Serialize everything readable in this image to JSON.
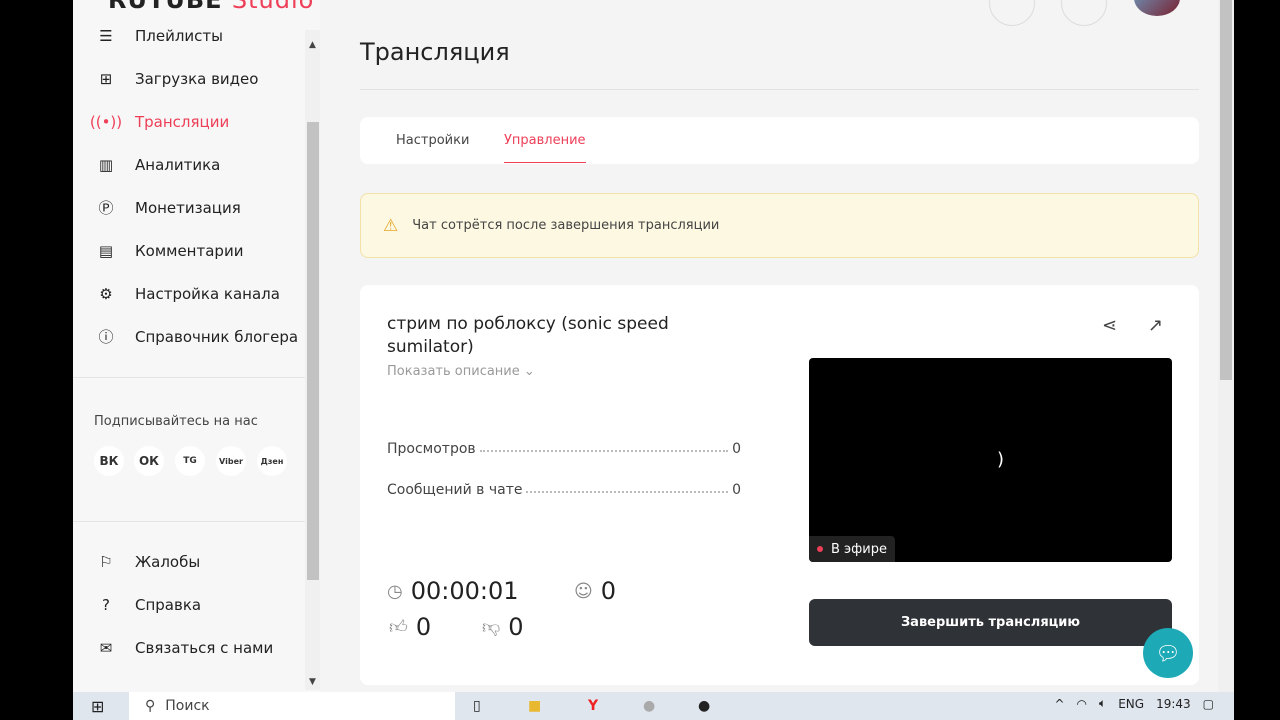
{
  "logo": {
    "brand": "RUTUBE",
    "studio": "Studio"
  },
  "sidebar": {
    "items": [
      {
        "label": "Плейлисты",
        "icon": "list-icon"
      },
      {
        "label": "Загрузка видео",
        "icon": "upload-file-icon"
      },
      {
        "label": "Трансляции",
        "icon": "broadcast-icon"
      },
      {
        "label": "Аналитика",
        "icon": "chart-icon"
      },
      {
        "label": "Монетизация",
        "icon": "ruble-icon"
      },
      {
        "label": "Комментарии",
        "icon": "comment-icon"
      },
      {
        "label": "Настройка канала",
        "icon": "gear-icon"
      },
      {
        "label": "Справочник блогера",
        "icon": "info-icon"
      }
    ],
    "follow_label": "Подписывайтесь на нас",
    "social": [
      "ВК",
      "ОК",
      "TG",
      "Viber",
      "Дзен"
    ],
    "bottom": [
      {
        "label": "Жалобы",
        "icon": "flag-icon"
      },
      {
        "label": "Справка",
        "icon": "help-icon"
      },
      {
        "label": "Связаться с нами",
        "icon": "mail-icon"
      }
    ]
  },
  "main": {
    "title": "Трансляция",
    "tabs": [
      "Настройки",
      "Управление"
    ],
    "warning": "Чат сотрётся после завершения трансляции",
    "stream": {
      "title": "стрим по роблоксу (sonic speed sumilator)",
      "show_description": "Показать описание",
      "views_label": "Просмотров",
      "views": "0",
      "messages_label": "Сообщений в чате",
      "messages": "0",
      "duration": "00:00:01",
      "viewers": "0",
      "likes": "0",
      "dislikes": "0",
      "live_label": "В эфире",
      "end_button": "Завершить трансляцию"
    }
  },
  "taskbar": {
    "search": "Поиск",
    "lang": "ENG",
    "time": "19:43"
  },
  "colors": {
    "accent": "#ee3f58",
    "button": "#2f3338",
    "chat": "#1da9b5"
  }
}
